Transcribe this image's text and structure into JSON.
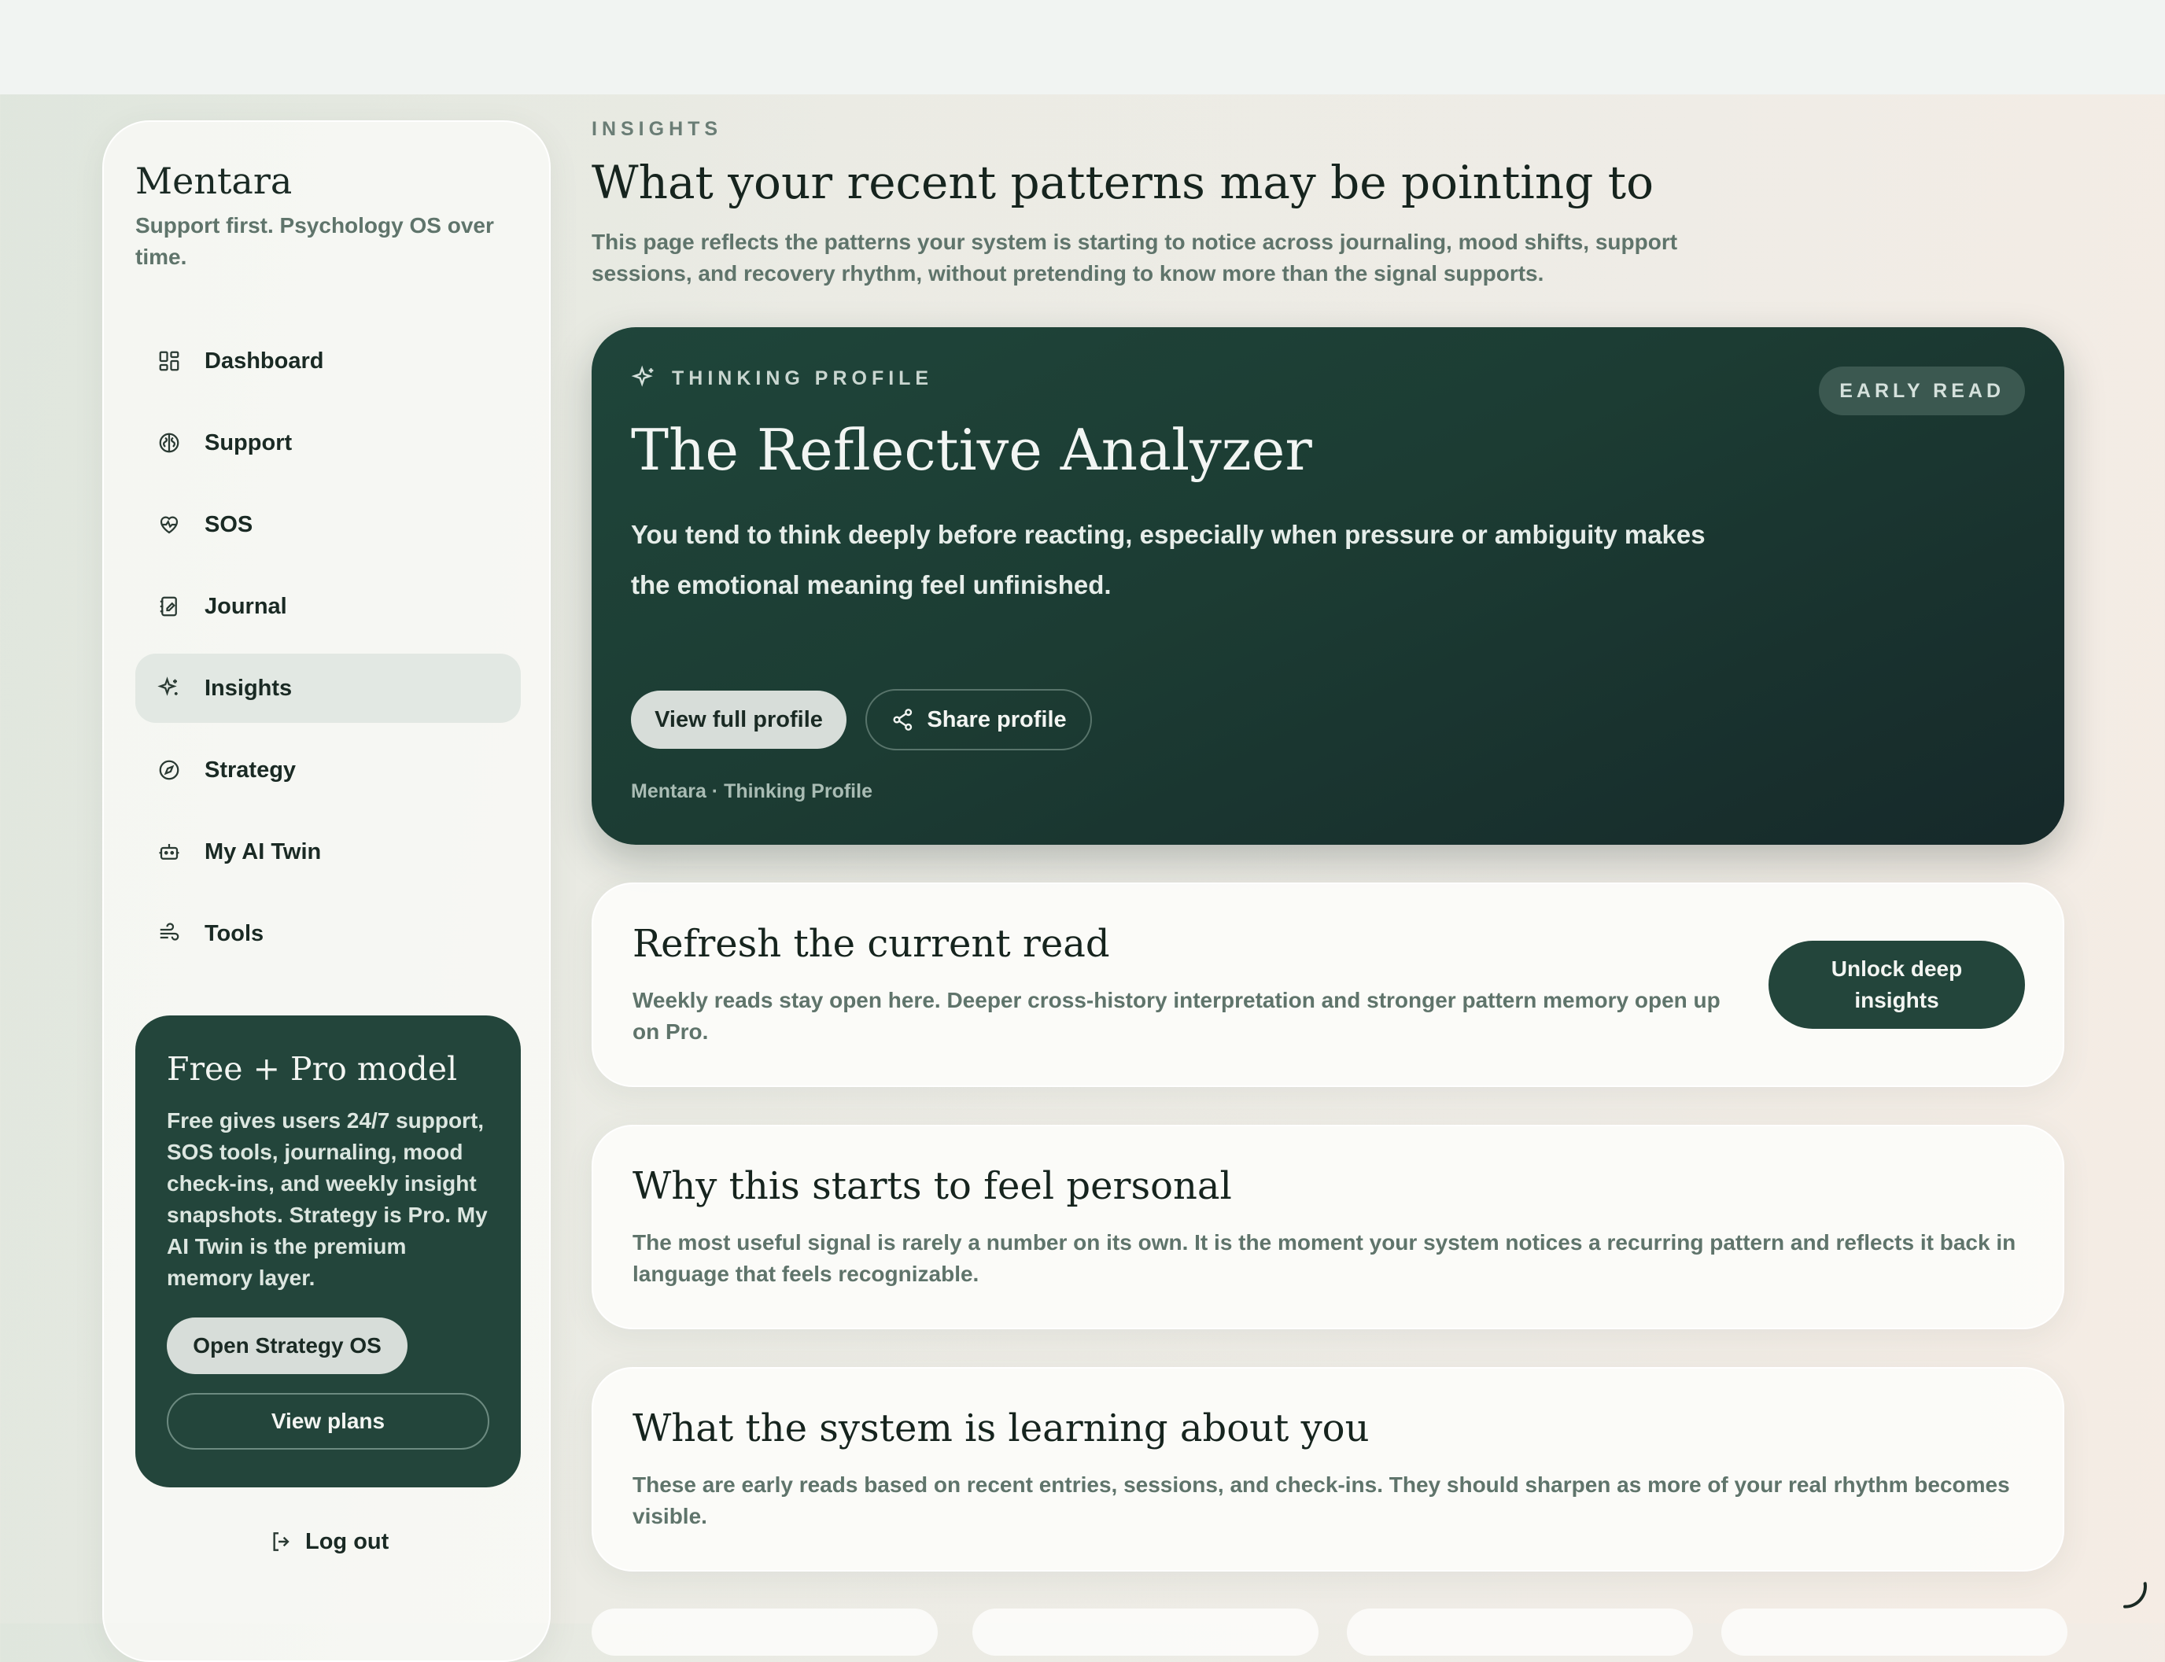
{
  "sidebar": {
    "brand": "Mentara",
    "tagline": "Support first. Psychology OS over time.",
    "items": [
      {
        "label": "Dashboard",
        "icon": "dashboard-icon"
      },
      {
        "label": "Support",
        "icon": "brain-icon"
      },
      {
        "label": "SOS",
        "icon": "heart-pulse-icon"
      },
      {
        "label": "Journal",
        "icon": "notebook-icon"
      },
      {
        "label": "Insights",
        "icon": "sparkles-icon",
        "active": true
      },
      {
        "label": "Strategy",
        "icon": "compass-icon"
      },
      {
        "label": "My AI Twin",
        "icon": "bot-icon"
      },
      {
        "label": "Tools",
        "icon": "wind-icon"
      }
    ],
    "promo": {
      "title": "Free + Pro model",
      "text": "Free gives users 24/7 support, SOS tools, journaling, mood check-ins, and weekly insight snapshots. Strategy is Pro. My AI Twin is the premium memory layer.",
      "primary_label": "Open Strategy OS",
      "secondary_label": "View plans"
    },
    "logout_label": "Log out"
  },
  "header": {
    "eyebrow": "INSIGHTS",
    "title": "What your recent patterns may be pointing to",
    "subtitle": "This page reflects the patterns your system is starting to notice across journaling, mood shifts, support sessions, and recovery rhythm, without pretending to know more than the signal supports."
  },
  "profile": {
    "eyebrow": "THINKING PROFILE",
    "badge": "EARLY READ",
    "title": "The Reflective Analyzer",
    "description": "You tend to think deeply before reacting, especially when pressure or ambiguity makes the emotional meaning feel unfinished.",
    "view_label": "View full profile",
    "share_label": "Share profile",
    "footer": "Mentara · Thinking Profile"
  },
  "cards": [
    {
      "title": "Refresh the current read",
      "text": "Weekly reads stay open here. Deeper cross-history interpretation and stronger pattern memory open up on Pro.",
      "button_label": "Unlock deep insights"
    },
    {
      "title": "Why this starts to feel personal",
      "text": "The most useful signal is rarely a number on its own. It is the moment your system notices a recurring pattern and reflects it back in language that feels recognizable."
    },
    {
      "title": "What the system is learning about you",
      "text": "These are early reads based on recent entries, sessions, and check-ins. They should sharpen as more of your real rhythm becomes visible."
    }
  ],
  "colors": {
    "accent": "#23453b",
    "hero_bg": "#1f453a",
    "muted_text": "#5f746b"
  }
}
